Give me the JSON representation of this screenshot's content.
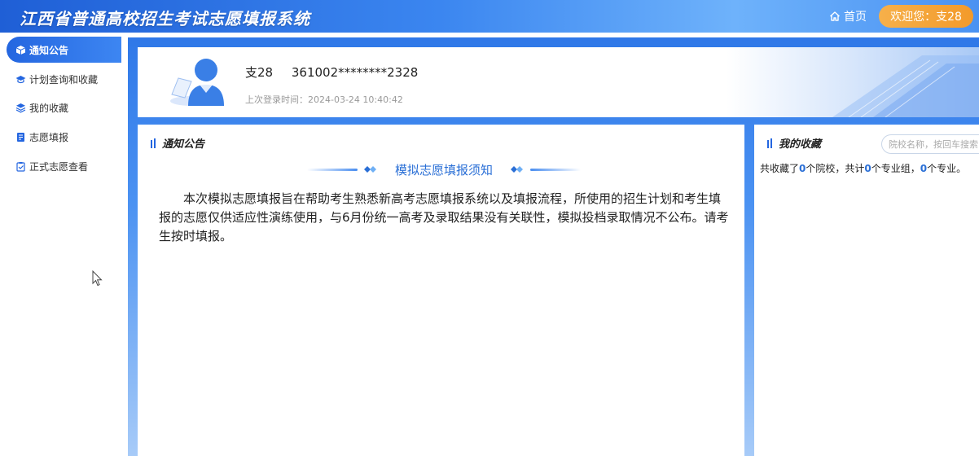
{
  "header": {
    "title": "江西省普通高校招生考试志愿填报系统",
    "home_label": "首页",
    "welcome_text": "欢迎您：支28"
  },
  "sidebar": {
    "items": [
      {
        "label": "通知公告",
        "icon": "cube-icon",
        "active": true
      },
      {
        "label": "计划查询和收藏",
        "icon": "graduation-cap-icon",
        "active": false
      },
      {
        "label": "我的收藏",
        "icon": "layers-icon",
        "active": false
      },
      {
        "label": "志愿填报",
        "icon": "document-icon",
        "active": false
      },
      {
        "label": "正式志愿查看",
        "icon": "clipboard-check-icon",
        "active": false
      }
    ]
  },
  "profile": {
    "name": "支28",
    "id_number": "361002********2328",
    "last_login": "上次登录时间：2024-03-24 10:40:42"
  },
  "notice": {
    "panel_title": "通知公告",
    "heading": "模拟志愿填报须知",
    "body": "本次模拟志愿填报旨在帮助考生熟悉新高考志愿填报系统以及填报流程，所使用的招生计划和考生填报的志愿仅供适应性演练使用，与6月份统一高考及录取结果没有关联性，模拟投档录取情况不公布。请考生按时填报。"
  },
  "favorites": {
    "panel_title": "我的收藏",
    "search_placeholder": "院校名称，按回车搜索",
    "summary_prefix": "共收藏了",
    "college_count": "0",
    "summary_mid1": "个院校，共计",
    "group_count": "0",
    "summary_mid2": "个专业组，",
    "major_count": "0",
    "summary_suffix": "个专业。"
  },
  "colors": {
    "primary": "#2466e0",
    "accent_orange": "#f39a2a",
    "link_blue": "#2a6fd6"
  }
}
